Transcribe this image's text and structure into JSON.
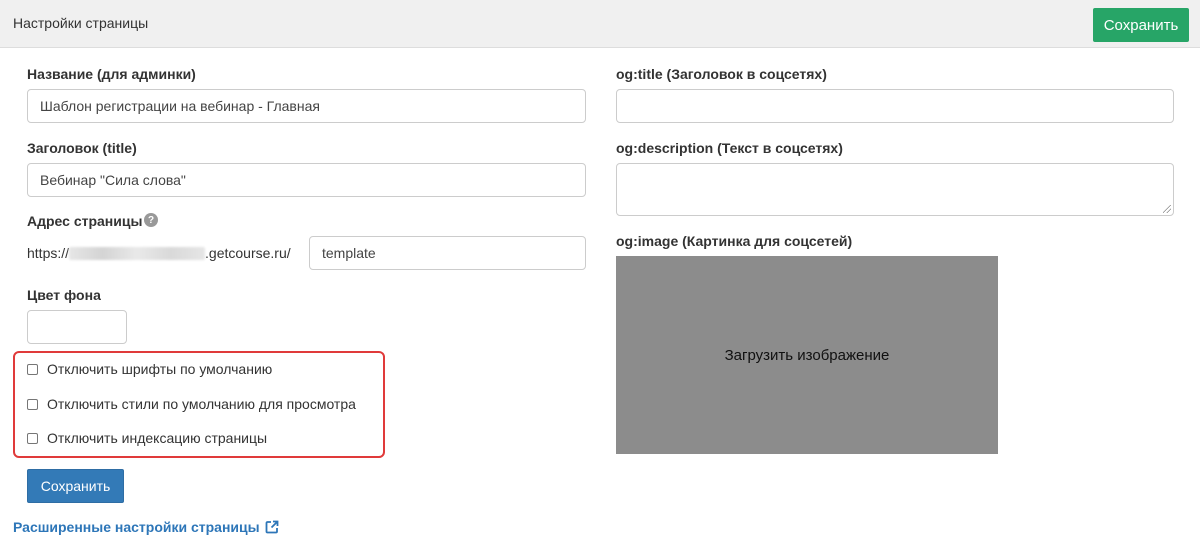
{
  "header": {
    "title": "Настройки страницы",
    "save_label": "Сохранить"
  },
  "form": {
    "name_label": "Название (для админки)",
    "name_value": "Шаблон регистрации на вебинар - Главная",
    "title_label": "Заголовок (title)",
    "title_value": "Вебинар \"Сила слова\"",
    "address_label": "Адрес страницы",
    "address_help_icon": "question-circle-icon",
    "url_prefix_start": "https://",
    "url_prefix_end": ".getcourse.ru/",
    "slug_value": "template",
    "bg_color_label": "Цвет фона",
    "bg_color_value": "",
    "checkboxes": [
      {
        "label": "Отключить шрифты по умолчанию",
        "checked": false
      },
      {
        "label": "Отключить стили по умолчанию для просмотра",
        "checked": false
      },
      {
        "label": "Отключить индексацию страницы",
        "checked": false
      }
    ],
    "save_label": "Сохранить",
    "advanced_link": "Расширенные настройки страницы",
    "advanced_link_icon": "external-link-icon"
  },
  "social": {
    "og_title_label": "og:title (Заголовок в соцсетях)",
    "og_title_value": "",
    "og_description_label": "og:description (Текст в соцсетях)",
    "og_description_value": "",
    "og_image_label": "og:image (Картинка для соцсетей)",
    "upload_label": "Загрузить изображение"
  },
  "colors": {
    "save_green": "#27a567",
    "save_blue": "#337ab7",
    "link_blue": "#2d76b8",
    "highlight_red": "#e03a3a",
    "image_placeholder": "#8c8c8c"
  }
}
